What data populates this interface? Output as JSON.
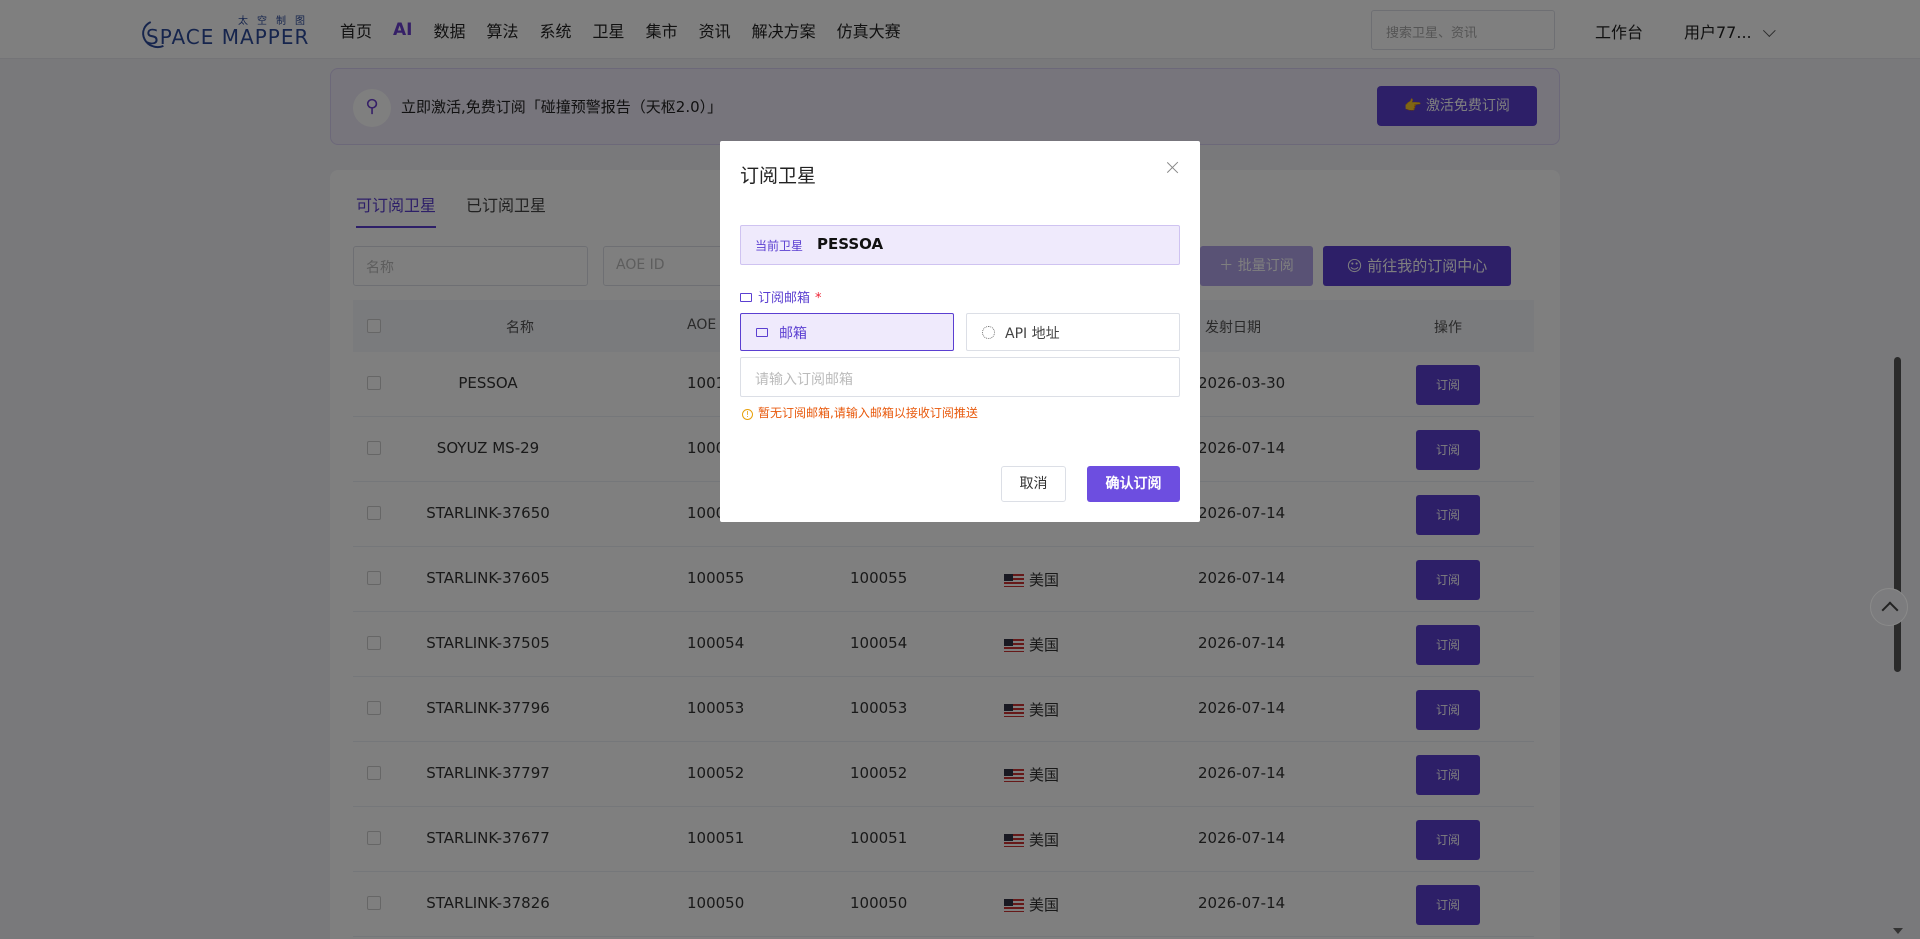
{
  "header": {
    "logo_cn": "太空制图",
    "logo_en": "SPACE MAPPER",
    "nav": [
      "首页",
      "AI",
      "数据",
      "算法",
      "系统",
      "卫星",
      "集市",
      "资讯",
      "解决方案",
      "仿真大赛"
    ],
    "search_placeholder": "搜索卫星、资讯",
    "workbench": "工作台",
    "user": "用户77..."
  },
  "banner": {
    "text": "立即激活,免费订阅「碰撞预警报告（天枢2.0）」",
    "button": "激活免费订阅"
  },
  "tabs": [
    "可订阅卫星",
    "已订阅卫星"
  ],
  "filters": {
    "name_placeholder": "名称",
    "aoe_placeholder": "AOE ID"
  },
  "buttons": {
    "batch": "批量订阅",
    "center": "前往我的订阅中心"
  },
  "table": {
    "headers": {
      "name": "名称",
      "aoe": "AOE",
      "launch": "发射日期",
      "action": "操作"
    },
    "rows": [
      {
        "name": "PESSOA",
        "aoe": "1001",
        "id": "",
        "country": "",
        "date": "2026-03-30",
        "action": "订阅"
      },
      {
        "name": "SOYUZ MS-29",
        "aoe": "1000",
        "id": "",
        "country": "",
        "date": "2026-07-14",
        "action": "订阅"
      },
      {
        "name": "STARLINK-37650",
        "aoe": "1000",
        "id": "",
        "country": "",
        "date": "2026-07-14",
        "action": "订阅"
      },
      {
        "name": "STARLINK-37605",
        "aoe": "100055",
        "id": "100055",
        "country": "美国",
        "date": "2026-07-14",
        "action": "订阅"
      },
      {
        "name": "STARLINK-37505",
        "aoe": "100054",
        "id": "100054",
        "country": "美国",
        "date": "2026-07-14",
        "action": "订阅"
      },
      {
        "name": "STARLINK-37796",
        "aoe": "100053",
        "id": "100053",
        "country": "美国",
        "date": "2026-07-14",
        "action": "订阅"
      },
      {
        "name": "STARLINK-37797",
        "aoe": "100052",
        "id": "100052",
        "country": "美国",
        "date": "2026-07-14",
        "action": "订阅"
      },
      {
        "name": "STARLINK-37677",
        "aoe": "100051",
        "id": "100051",
        "country": "美国",
        "date": "2026-07-14",
        "action": "订阅"
      },
      {
        "name": "STARLINK-37826",
        "aoe": "100050",
        "id": "100050",
        "country": "美国",
        "date": "2026-07-14",
        "action": "订阅"
      }
    ]
  },
  "modal": {
    "title": "订阅卫星",
    "current_label": "当前卫星",
    "current_value": "PESSOA",
    "email_label": "订阅邮箱",
    "required": "*",
    "option_email": "邮箱",
    "option_api": "API 地址",
    "email_placeholder": "请输入订阅邮箱",
    "warning": "暂无订阅邮箱,请输入邮箱以接收订阅推送",
    "warning_icon": "!",
    "cancel": "取消",
    "confirm": "确认订阅"
  },
  "colors": {
    "accent": "#5b3fd1",
    "warning": "#e8590c"
  }
}
